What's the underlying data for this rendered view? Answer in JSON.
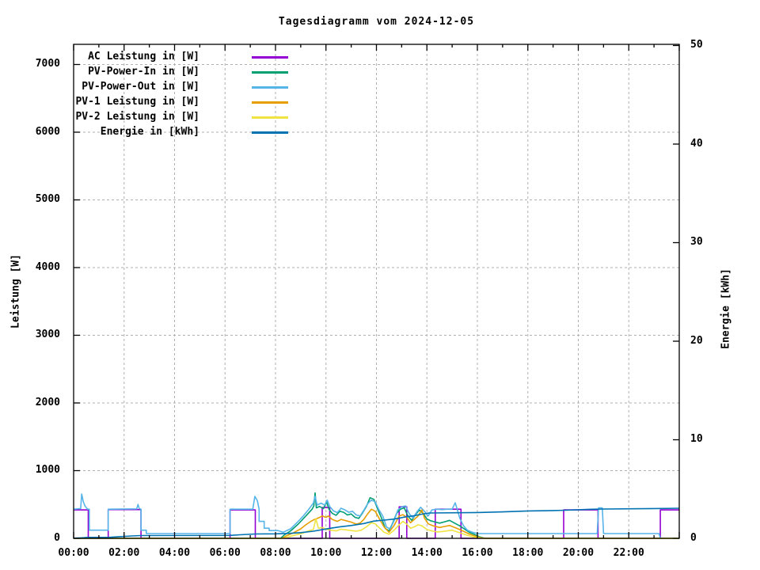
{
  "title": "Tagesdiagramm vom 2024-12-05",
  "chart_data": {
    "type": "line",
    "title": "Tagesdiagramm vom 2024-12-05",
    "grid": {
      "on": true,
      "color": "#b0b0b0",
      "dash": "3,3"
    },
    "x_axis": {
      "range_hours": [
        0,
        24
      ],
      "major_tick_step_hours": 2,
      "minor_tick_step_hours": 1,
      "tick_labels": [
        "00:00",
        "02:00",
        "04:00",
        "06:00",
        "08:00",
        "10:00",
        "12:00",
        "14:00",
        "16:00",
        "18:00",
        "20:00",
        "22:00"
      ]
    },
    "left_axis": {
      "label": "Leistung [W]",
      "ticks": [
        0,
        1000,
        2000,
        3000,
        4000,
        5000,
        6000,
        7000
      ],
      "range": [
        0,
        7298
      ]
    },
    "right_axis": {
      "label": "Energie [kWh]",
      "ticks": [
        0,
        10,
        20,
        30,
        40,
        50
      ],
      "range": [
        0,
        50.12
      ]
    },
    "legend_position": "top-left-inside",
    "series": [
      {
        "name": "AC Leistung in [W]",
        "color": "#9400d3",
        "axis": "left",
        "points": [
          [
            0,
            420
          ],
          [
            0.58,
            420
          ],
          [
            0.58,
            0
          ],
          [
            1.37,
            0
          ],
          [
            1.37,
            425
          ],
          [
            2.67,
            425
          ],
          [
            2.67,
            0
          ],
          [
            6.2,
            0
          ],
          [
            6.2,
            420
          ],
          [
            7.2,
            420
          ],
          [
            7.2,
            0
          ],
          [
            9.85,
            0
          ],
          [
            9.85,
            455
          ],
          [
            10.15,
            455
          ],
          [
            10.15,
            0
          ],
          [
            12.9,
            0
          ],
          [
            12.9,
            465
          ],
          [
            13.2,
            465
          ],
          [
            13.2,
            0
          ],
          [
            14.33,
            0
          ],
          [
            14.33,
            430
          ],
          [
            15.35,
            430
          ],
          [
            15.35,
            0
          ],
          [
            19.42,
            0
          ],
          [
            19.42,
            420
          ],
          [
            20.78,
            420
          ],
          [
            20.78,
            0
          ],
          [
            23.25,
            0
          ],
          [
            23.25,
            420
          ],
          [
            24,
            420
          ]
        ]
      },
      {
        "name": "PV-Power-In in [W]",
        "color": "#009e73",
        "axis": "left",
        "points": [
          [
            0,
            0
          ],
          [
            8.2,
            0
          ],
          [
            8.35,
            50
          ],
          [
            8.6,
            110
          ],
          [
            8.9,
            210
          ],
          [
            9.1,
            290
          ],
          [
            9.3,
            370
          ],
          [
            9.45,
            430
          ],
          [
            9.52,
            480
          ],
          [
            9.57,
            670
          ],
          [
            9.62,
            450
          ],
          [
            9.75,
            470
          ],
          [
            9.9,
            440
          ],
          [
            10.02,
            540
          ],
          [
            10.12,
            430
          ],
          [
            10.25,
            370
          ],
          [
            10.4,
            340
          ],
          [
            10.55,
            400
          ],
          [
            10.7,
            385
          ],
          [
            10.85,
            345
          ],
          [
            11.0,
            360
          ],
          [
            11.15,
            310
          ],
          [
            11.3,
            295
          ],
          [
            11.45,
            375
          ],
          [
            11.6,
            470
          ],
          [
            11.75,
            600
          ],
          [
            11.9,
            575
          ],
          [
            12.05,
            430
          ],
          [
            12.2,
            300
          ],
          [
            12.35,
            145
          ],
          [
            12.5,
            110
          ],
          [
            12.65,
            230
          ],
          [
            12.8,
            370
          ],
          [
            12.95,
            430
          ],
          [
            13.1,
            450
          ],
          [
            13.25,
            330
          ],
          [
            13.4,
            265
          ],
          [
            13.55,
            350
          ],
          [
            13.7,
            420
          ],
          [
            13.85,
            370
          ],
          [
            14.0,
            285
          ],
          [
            14.15,
            260
          ],
          [
            14.3,
            245
          ],
          [
            14.5,
            225
          ],
          [
            14.7,
            245
          ],
          [
            14.9,
            265
          ],
          [
            15.1,
            225
          ],
          [
            15.3,
            185
          ],
          [
            15.5,
            135
          ],
          [
            15.7,
            85
          ],
          [
            15.9,
            55
          ],
          [
            16.1,
            20
          ],
          [
            16.3,
            0
          ],
          [
            24,
            0
          ]
        ]
      },
      {
        "name": "PV-Power-Out in [W]",
        "color": "#56b4e9",
        "axis": "left",
        "points": [
          [
            0,
            430
          ],
          [
            0.28,
            440
          ],
          [
            0.32,
            655
          ],
          [
            0.38,
            545
          ],
          [
            0.45,
            480
          ],
          [
            0.55,
            430
          ],
          [
            0.62,
            430
          ],
          [
            0.62,
            120
          ],
          [
            1.37,
            120
          ],
          [
            1.37,
            430
          ],
          [
            2.5,
            435
          ],
          [
            2.55,
            500
          ],
          [
            2.6,
            440
          ],
          [
            2.67,
            430
          ],
          [
            2.67,
            120
          ],
          [
            2.88,
            120
          ],
          [
            2.88,
            70
          ],
          [
            6.2,
            70
          ],
          [
            6.2,
            430
          ],
          [
            7.1,
            430
          ],
          [
            7.18,
            620
          ],
          [
            7.28,
            555
          ],
          [
            7.35,
            430
          ],
          [
            7.35,
            250
          ],
          [
            7.55,
            250
          ],
          [
            7.55,
            150
          ],
          [
            7.75,
            150
          ],
          [
            7.75,
            115
          ],
          [
            8.1,
            115
          ],
          [
            8.3,
            90
          ],
          [
            8.6,
            140
          ],
          [
            8.9,
            250
          ],
          [
            9.1,
            330
          ],
          [
            9.3,
            420
          ],
          [
            9.5,
            520
          ],
          [
            9.57,
            620
          ],
          [
            9.65,
            490
          ],
          [
            9.8,
            520
          ],
          [
            9.95,
            490
          ],
          [
            10.05,
            565
          ],
          [
            10.15,
            470
          ],
          [
            10.3,
            405
          ],
          [
            10.45,
            380
          ],
          [
            10.6,
            445
          ],
          [
            10.75,
            420
          ],
          [
            10.9,
            385
          ],
          [
            11.05,
            400
          ],
          [
            11.2,
            345
          ],
          [
            11.35,
            330
          ],
          [
            11.5,
            415
          ],
          [
            11.65,
            510
          ],
          [
            11.8,
            565
          ],
          [
            11.95,
            540
          ],
          [
            12.1,
            420
          ],
          [
            12.25,
            330
          ],
          [
            12.4,
            165
          ],
          [
            12.55,
            140
          ],
          [
            12.7,
            260
          ],
          [
            12.85,
            420
          ],
          [
            13.0,
            465
          ],
          [
            13.15,
            480
          ],
          [
            13.3,
            365
          ],
          [
            13.45,
            300
          ],
          [
            13.6,
            390
          ],
          [
            13.75,
            460
          ],
          [
            13.9,
            400
          ],
          [
            14.05,
            330
          ],
          [
            14.2,
            420
          ],
          [
            14.4,
            430
          ],
          [
            14.6,
            425
          ],
          [
            14.8,
            430
          ],
          [
            15.0,
            430
          ],
          [
            15.12,
            525
          ],
          [
            15.2,
            430
          ],
          [
            15.3,
            300
          ],
          [
            15.45,
            185
          ],
          [
            15.6,
            120
          ],
          [
            15.8,
            90
          ],
          [
            16.0,
            70
          ],
          [
            20.75,
            70
          ],
          [
            20.8,
            450
          ],
          [
            20.95,
            450
          ],
          [
            21.0,
            70
          ],
          [
            23.2,
            70
          ],
          [
            23.25,
            0
          ],
          [
            24,
            0
          ]
        ]
      },
      {
        "name": "PV-1 Leistung in [W]",
        "color": "#e69f00",
        "axis": "left",
        "points": [
          [
            0,
            0
          ],
          [
            8.25,
            0
          ],
          [
            8.45,
            40
          ],
          [
            8.7,
            80
          ],
          [
            9.0,
            140
          ],
          [
            9.2,
            200
          ],
          [
            9.4,
            250
          ],
          [
            9.55,
            280
          ],
          [
            9.7,
            300
          ],
          [
            9.85,
            330
          ],
          [
            10.0,
            310
          ],
          [
            10.1,
            330
          ],
          [
            10.25,
            280
          ],
          [
            10.45,
            250
          ],
          [
            10.6,
            280
          ],
          [
            10.8,
            260
          ],
          [
            11.0,
            240
          ],
          [
            11.2,
            210
          ],
          [
            11.35,
            225
          ],
          [
            11.5,
            280
          ],
          [
            11.65,
            360
          ],
          [
            11.8,
            430
          ],
          [
            11.95,
            400
          ],
          [
            12.1,
            300
          ],
          [
            12.3,
            170
          ],
          [
            12.5,
            90
          ],
          [
            12.7,
            190
          ],
          [
            12.9,
            330
          ],
          [
            13.05,
            350
          ],
          [
            13.2,
            310
          ],
          [
            13.35,
            230
          ],
          [
            13.5,
            280
          ],
          [
            13.65,
            330
          ],
          [
            13.8,
            420
          ],
          [
            13.9,
            300
          ],
          [
            14.05,
            215
          ],
          [
            14.25,
            185
          ],
          [
            14.5,
            160
          ],
          [
            14.7,
            175
          ],
          [
            14.9,
            190
          ],
          [
            15.1,
            160
          ],
          [
            15.3,
            130
          ],
          [
            15.5,
            95
          ],
          [
            15.7,
            60
          ],
          [
            15.9,
            35
          ],
          [
            16.1,
            10
          ],
          [
            16.3,
            0
          ],
          [
            24,
            0
          ]
        ]
      },
      {
        "name": "PV-2 Leistung in [W]",
        "color": "#f0e442",
        "axis": "left",
        "points": [
          [
            0,
            0
          ],
          [
            8.3,
            0
          ],
          [
            8.55,
            25
          ],
          [
            8.8,
            50
          ],
          [
            9.1,
            80
          ],
          [
            9.3,
            110
          ],
          [
            9.5,
            130
          ],
          [
            9.6,
            290
          ],
          [
            9.7,
            150
          ],
          [
            9.85,
            160
          ],
          [
            10.0,
            135
          ],
          [
            10.2,
            120
          ],
          [
            10.4,
            110
          ],
          [
            10.6,
            135
          ],
          [
            10.8,
            125
          ],
          [
            11.0,
            115
          ],
          [
            11.2,
            105
          ],
          [
            11.4,
            120
          ],
          [
            11.6,
            170
          ],
          [
            11.8,
            230
          ],
          [
            11.95,
            215
          ],
          [
            12.1,
            160
          ],
          [
            12.3,
            90
          ],
          [
            12.5,
            60
          ],
          [
            12.7,
            120
          ],
          [
            12.9,
            200
          ],
          [
            13.05,
            250
          ],
          [
            13.2,
            210
          ],
          [
            13.35,
            150
          ],
          [
            13.5,
            170
          ],
          [
            13.65,
            200
          ],
          [
            13.8,
            185
          ],
          [
            14.0,
            130
          ],
          [
            14.2,
            110
          ],
          [
            14.4,
            95
          ],
          [
            14.6,
            100
          ],
          [
            14.8,
            110
          ],
          [
            15.0,
            120
          ],
          [
            15.2,
            95
          ],
          [
            15.4,
            70
          ],
          [
            15.6,
            45
          ],
          [
            15.8,
            25
          ],
          [
            16.0,
            10
          ],
          [
            16.2,
            0
          ],
          [
            24,
            0
          ]
        ]
      },
      {
        "name": "Energie in [kWh]",
        "color": "#0072b2",
        "axis": "right",
        "points": [
          [
            0,
            0.02
          ],
          [
            0.3,
            0.05
          ],
          [
            0.6,
            0.1
          ],
          [
            1.37,
            0.1
          ],
          [
            1.8,
            0.17
          ],
          [
            2.3,
            0.24
          ],
          [
            2.67,
            0.28
          ],
          [
            6.2,
            0.3
          ],
          [
            6.6,
            0.36
          ],
          [
            7.2,
            0.44
          ],
          [
            8.0,
            0.46
          ],
          [
            8.5,
            0.5
          ],
          [
            9.0,
            0.58
          ],
          [
            9.5,
            0.72
          ],
          [
            10.0,
            0.95
          ],
          [
            10.5,
            1.15
          ],
          [
            11.0,
            1.3
          ],
          [
            11.5,
            1.5
          ],
          [
            11.9,
            1.75
          ],
          [
            12.3,
            1.85
          ],
          [
            12.7,
            1.95
          ],
          [
            13.1,
            2.15
          ],
          [
            13.5,
            2.3
          ],
          [
            13.9,
            2.5
          ],
          [
            14.1,
            2.57
          ],
          [
            16.0,
            2.62
          ],
          [
            17.0,
            2.68
          ],
          [
            18.0,
            2.78
          ],
          [
            19.0,
            2.82
          ],
          [
            19.5,
            2.85
          ],
          [
            20.5,
            2.95
          ],
          [
            21.0,
            2.97
          ],
          [
            22.5,
            3.0
          ],
          [
            23.0,
            3.02
          ],
          [
            24,
            3.05
          ]
        ]
      }
    ]
  }
}
